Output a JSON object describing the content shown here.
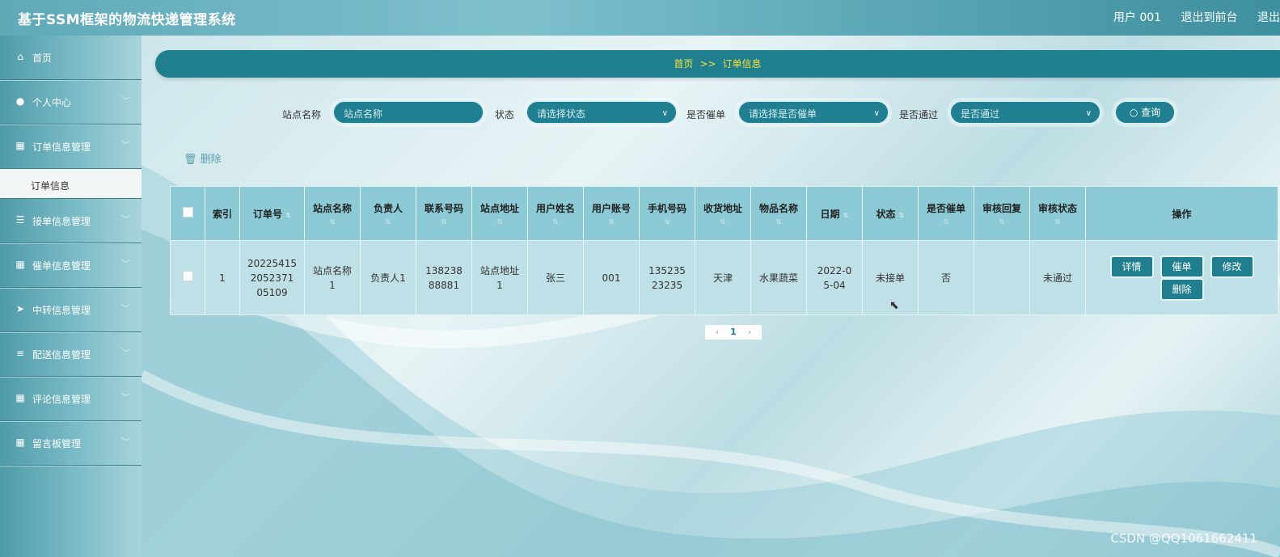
{
  "header": {
    "title": "基于SSM框架的物流快递管理系统",
    "user": "用户 001",
    "back_to_front": "退出到前台",
    "logout": "退出"
  },
  "sidebar": {
    "items": [
      {
        "label": "首页",
        "icon": "home-icon"
      },
      {
        "label": "个人中心",
        "icon": "user-icon"
      },
      {
        "label": "订单信息管理",
        "icon": "grid-icon"
      },
      {
        "label": "接单信息管理",
        "icon": "sliders-icon"
      },
      {
        "label": "催单信息管理",
        "icon": "grid-icon"
      },
      {
        "label": "中转信息管理",
        "icon": "send-icon"
      },
      {
        "label": "配送信息管理",
        "icon": "list-icon"
      },
      {
        "label": "评论信息管理",
        "icon": "grid-icon"
      },
      {
        "label": "留言板管理",
        "icon": "grid-icon"
      }
    ],
    "sub_item": "订单信息"
  },
  "breadcrumb": {
    "home": "首页",
    "sep": ">>",
    "current": "订单信息"
  },
  "search": {
    "station_label": "站点名称",
    "station_placeholder": "站点名称",
    "status_label": "状态",
    "status_placeholder": "请选择状态",
    "urge_label": "是否催单",
    "urge_placeholder": "请选择是否催单",
    "pass_label": "是否通过",
    "pass_placeholder": "是否通过",
    "query_label": "查询"
  },
  "toolbar": {
    "delete_label": "删除"
  },
  "table": {
    "headers": [
      "索引",
      "订单号",
      "站点名称",
      "负责人",
      "联系号码",
      "站点地址",
      "用户姓名",
      "用户账号",
      "手机号码",
      "收货地址",
      "物品名称",
      "日期",
      "状态",
      "是否催单",
      "审核回复",
      "审核状态",
      "操作"
    ],
    "row": {
      "index": "1",
      "order_no": "202254152052371 05109",
      "station": "站点名称1",
      "manager": "负责人1",
      "contact": "13823888881",
      "address": "站点地址1",
      "user_name": "张三",
      "account": "001",
      "phone": "13523523235",
      "delivery": "天津",
      "item": "水果蔬菜",
      "date": "2022-05-04",
      "status": "未接单",
      "urged": "否",
      "reply": "",
      "audit": "未通过"
    },
    "actions": {
      "detail": "详情",
      "urge": "催单",
      "edit": "修改",
      "delete": "删除"
    }
  },
  "pager": {
    "page": "1",
    "prev": "‹",
    "next": "›"
  },
  "watermark": "CSDN @QQ1061662411"
}
